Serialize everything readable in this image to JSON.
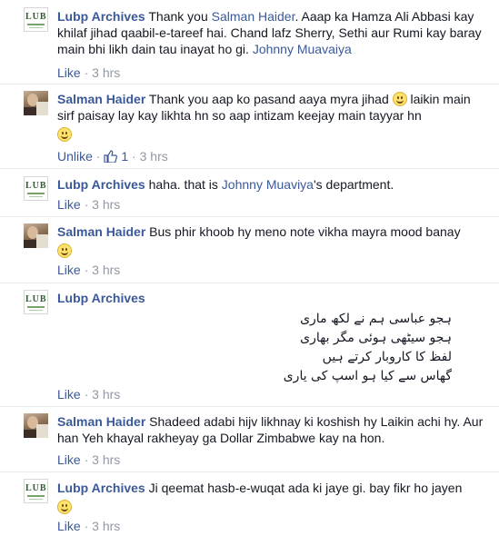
{
  "comments": [
    {
      "author": "Lubp Archives",
      "text_part1": " Thank you ",
      "mention1": "Salman Haider",
      "text_part2": ". Aaap ka Hamza Ali Abbasi kay khilaf jihad qaabil-e-tareef hai. Chand lafz Sherry, Sethi aur Rumi kay baray main bhi likh dain tau inayat ho gi. ",
      "mention2": "Johnny Muavaiya",
      "like": "Like",
      "time": "3 hrs"
    },
    {
      "author": "Salman Haider",
      "text_part1": " Thank you aap ko pasand aaya myra jihad ",
      "text_part2": " laikin main sirf paisay lay kay likhta hn so aap intizam keejay main tayyar hn",
      "emoji1": "smile-emoji",
      "emoji2": "smile-emoji",
      "unlike": "Unlike",
      "like_count": "1",
      "time": "3 hrs"
    },
    {
      "author": "Lubp Archives",
      "text_part1": " haha. that is ",
      "mention1": "Johnny Muaviya",
      "text_part2": "'s department.",
      "like": "Like",
      "time": "3 hrs"
    },
    {
      "author": "Salman Haider",
      "text_part1": " Bus phir khoob hy meno note vikha mayra mood banay",
      "emoji1": "smile-emoji",
      "like": "Like",
      "time": "3 hrs"
    },
    {
      "author": "Lubp Archives",
      "poem": [
        "ہجو عباسی ہم نے لکھ ماری",
        "ہجو سیٹھی ہوئی مگر بھاری",
        "لفظ کا کاروبار کرتے ہیں",
        "گھاس سے کیا ہو اسپ کی یاری"
      ],
      "like": "Like",
      "time": "3 hrs"
    },
    {
      "author": "Salman Haider",
      "text_part1": " Shadeed adabi hijv likhnay ki koshish hy Laikin achi hy. Aur han Yeh khayal rakheyay ga Dollar Zimbabwe kay na hon.",
      "like": "Like",
      "time": "3 hrs"
    },
    {
      "author": "Lubp Archives",
      "text_part1": " Ji qeemat hasb-e-wuqat ada ki jaye gi. bay fikr ho jayen",
      "emoji1": "smile-emoji",
      "like": "Like",
      "time": "3 hrs"
    }
  ],
  "avatar_text": "LUB",
  "colors": {
    "link": "#3b5998",
    "meta": "#9197a3",
    "text": "#141823",
    "separator": "#e9eaed"
  }
}
